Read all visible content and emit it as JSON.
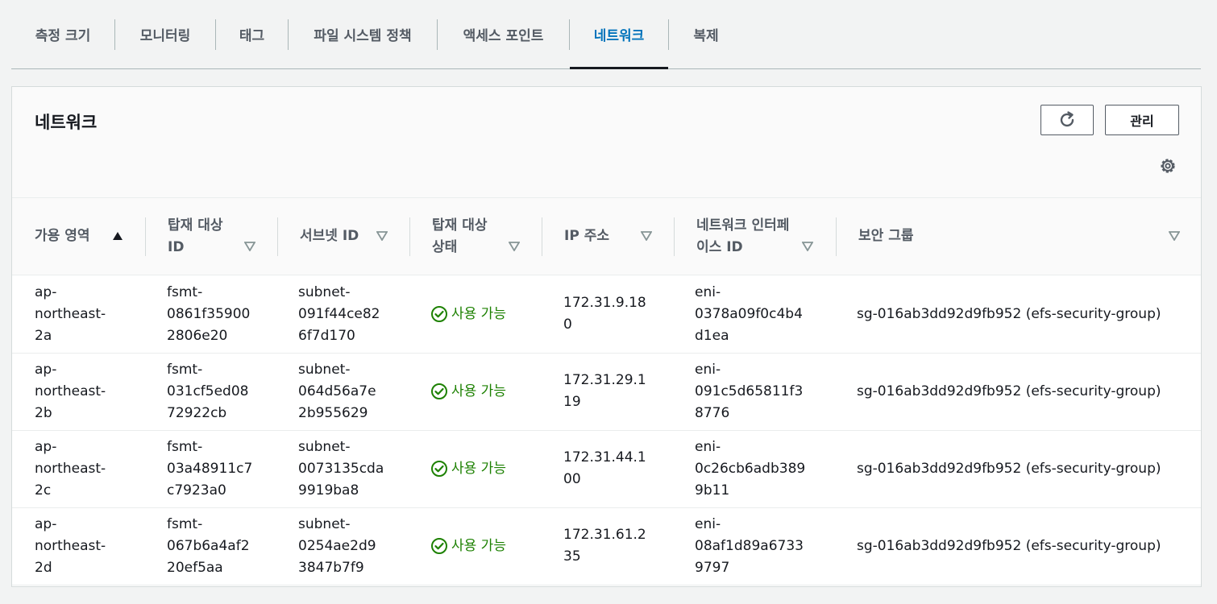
{
  "tabs": [
    {
      "label": "측정 크기"
    },
    {
      "label": "모니터링"
    },
    {
      "label": "태그"
    },
    {
      "label": "파일 시스템 정책"
    },
    {
      "label": "액세스 포인트"
    },
    {
      "label": "네트워크"
    },
    {
      "label": "복제"
    }
  ],
  "active_tab": "네트워크",
  "panel": {
    "title": "네트워크",
    "manage_label": "관리"
  },
  "columns": [
    {
      "line1": "가용 영역",
      "line2": ""
    },
    {
      "line1": "탑재 대상",
      "line2": "ID"
    },
    {
      "line1": "서브넷 ID",
      "line2": ""
    },
    {
      "line1": "탑재 대상",
      "line2": "상태"
    },
    {
      "line1": "IP 주소",
      "line2": ""
    },
    {
      "line1": "네트워크 인터페",
      "line2": "이스 ID"
    },
    {
      "line1": "보안 그룹",
      "line2": ""
    }
  ],
  "rows": [
    {
      "az": [
        "ap-",
        "northeast-",
        "2a"
      ],
      "mount_id": [
        "fsmt-",
        "0861f35900",
        "2806e20"
      ],
      "subnet": [
        "subnet-",
        "091f44ce82",
        "6f7d170"
      ],
      "status": "사용 가능",
      "ip": [
        "172.31.9.18",
        "0"
      ],
      "eni": [
        "eni-",
        "0378a09f0c4b4",
        "d1ea"
      ],
      "sg": "sg-016ab3dd92d9fb952 (efs-security-group)"
    },
    {
      "az": [
        "ap-",
        "northeast-",
        "2b"
      ],
      "mount_id": [
        "fsmt-",
        "031cf5ed08",
        "72922cb"
      ],
      "subnet": [
        "subnet-",
        "064d56a7e",
        "2b955629"
      ],
      "status": "사용 가능",
      "ip": [
        "172.31.29.1",
        "19"
      ],
      "eni": [
        "eni-",
        "091c5d65811f3",
        "8776"
      ],
      "sg": "sg-016ab3dd92d9fb952 (efs-security-group)"
    },
    {
      "az": [
        "ap-",
        "northeast-",
        "2c"
      ],
      "mount_id": [
        "fsmt-",
        "03a48911c7",
        "c7923a0"
      ],
      "subnet": [
        "subnet-",
        "0073135cda",
        "9919ba8"
      ],
      "status": "사용 가능",
      "ip": [
        "172.31.44.1",
        "00"
      ],
      "eni": [
        "eni-",
        "0c26cb6adb389",
        "9b11"
      ],
      "sg": "sg-016ab3dd92d9fb952 (efs-security-group)"
    },
    {
      "az": [
        "ap-",
        "northeast-",
        "2d"
      ],
      "mount_id": [
        "fsmt-",
        "067b6a4af2",
        "20ef5aa"
      ],
      "subnet": [
        "subnet-",
        "0254ae2d9",
        "3847b7f9"
      ],
      "status": "사용 가능",
      "ip": [
        "172.31.61.2",
        "35"
      ],
      "eni": [
        "eni-",
        "08af1d89a6733",
        "9797"
      ],
      "sg": "sg-016ab3dd92d9fb952 (efs-security-group)"
    }
  ],
  "icons": {
    "refresh": "refresh-icon",
    "settings": "gear-icon",
    "sort_asc": "sort-ascending-icon",
    "sort": "sort-descending-icon",
    "status_ok": "check-circle-icon"
  },
  "colors": {
    "link_active": "#0073bb",
    "status_ok": "#1d8102"
  }
}
